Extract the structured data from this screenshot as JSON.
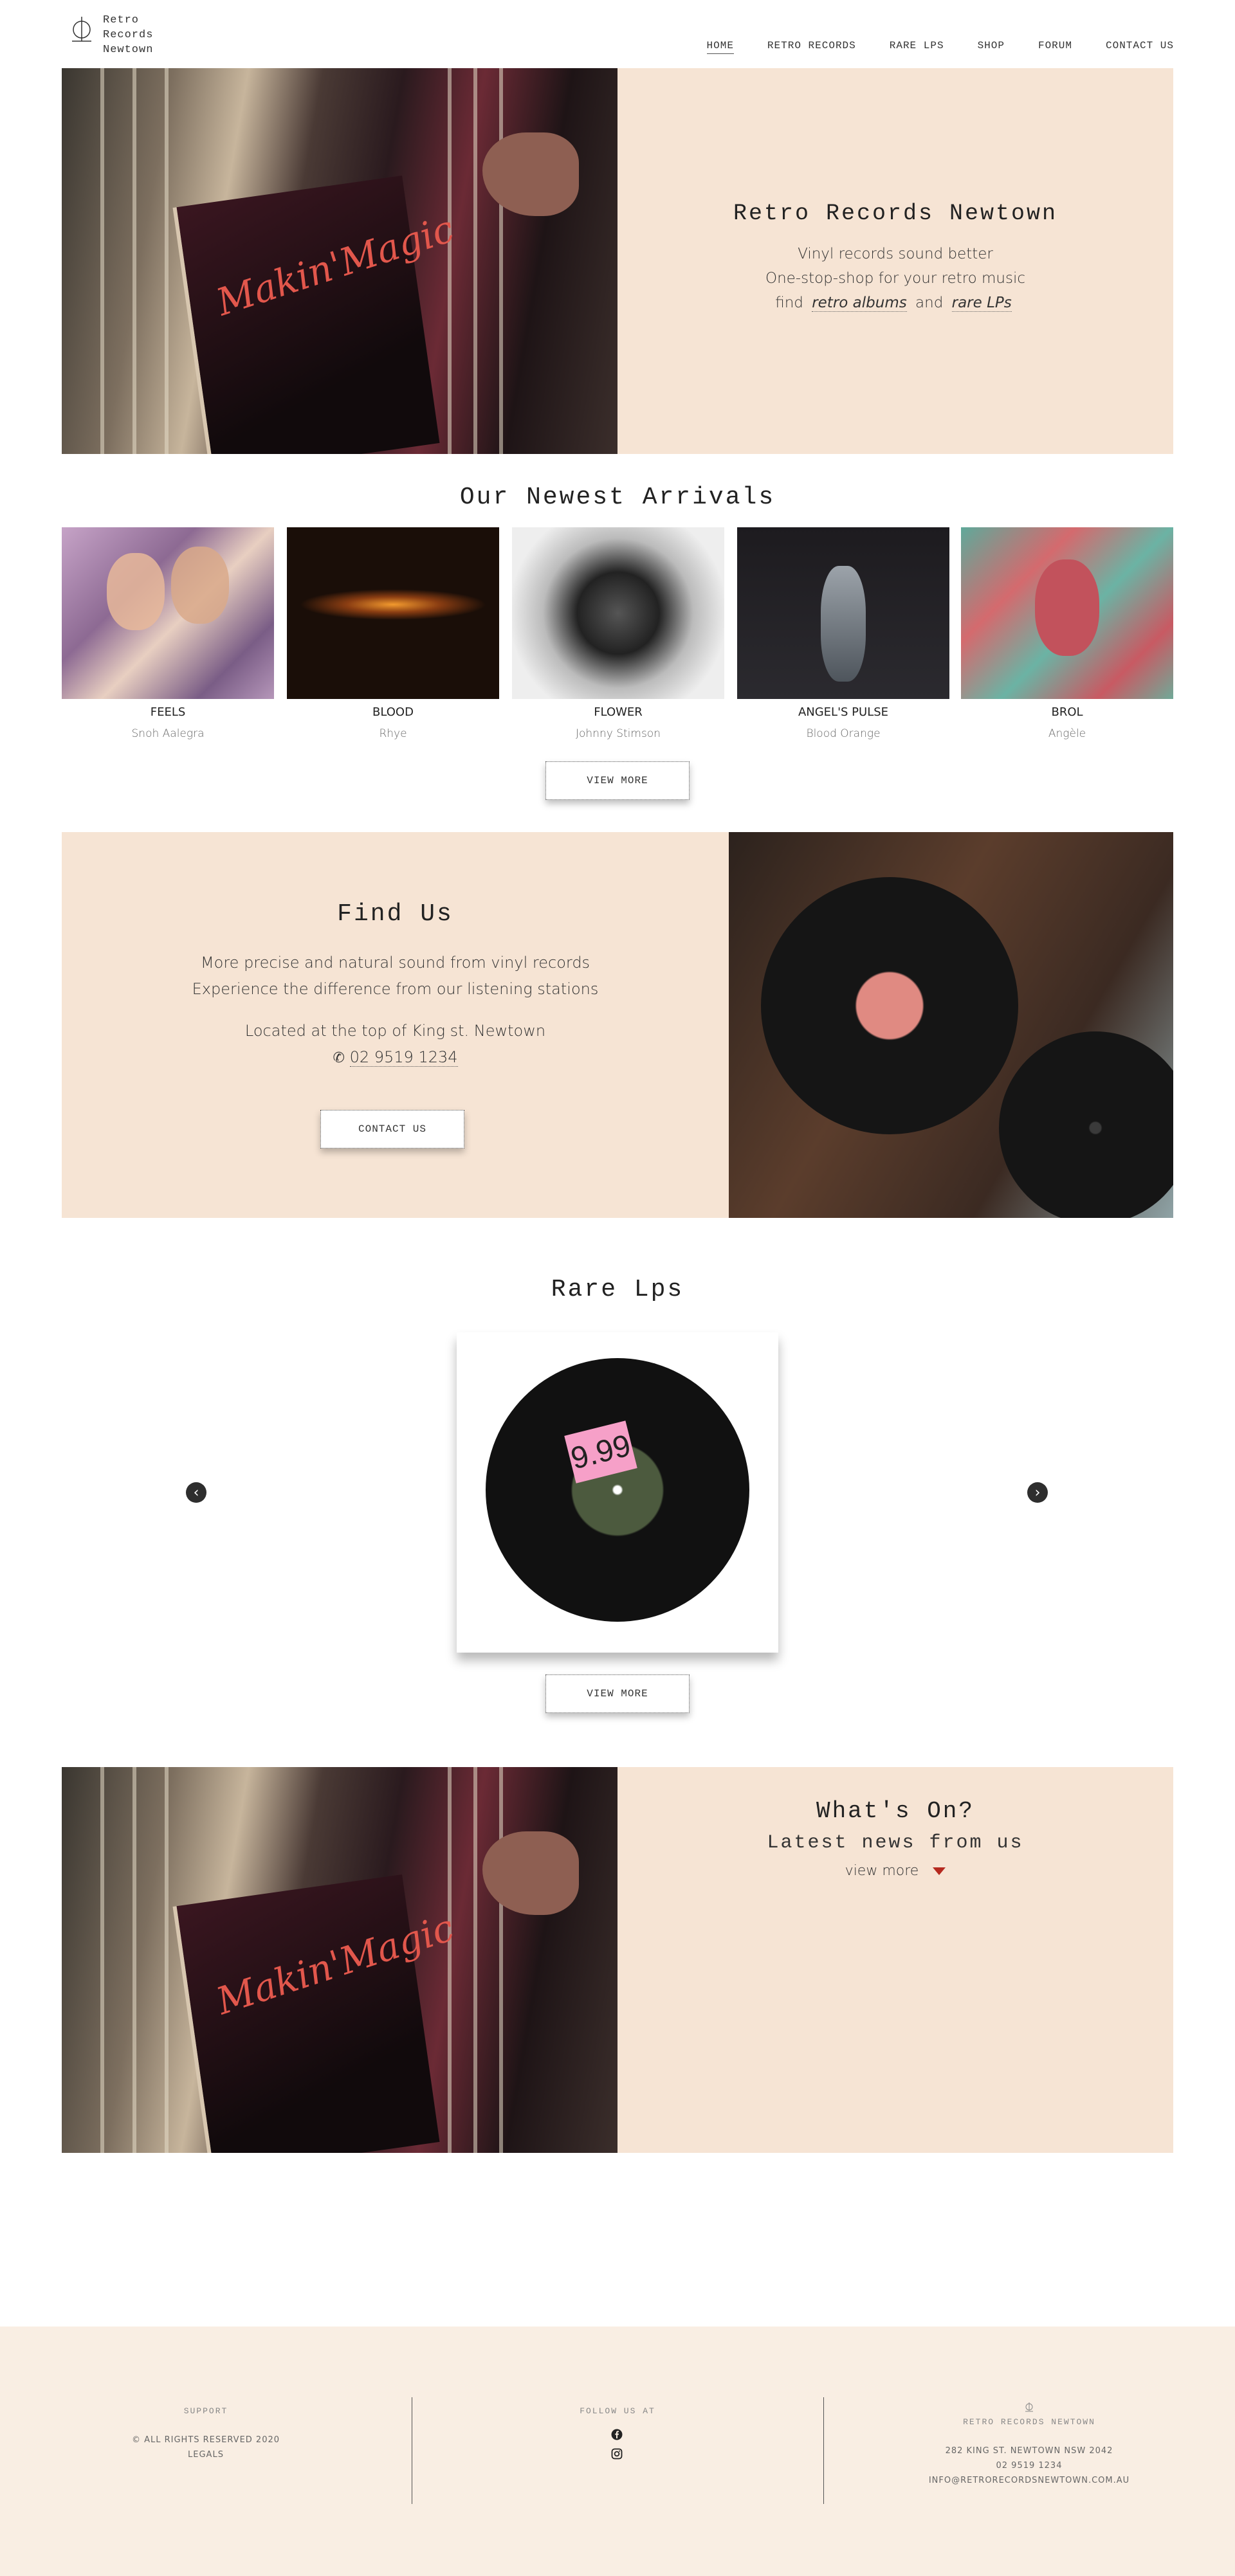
{
  "header": {
    "logo_line1": "Retro",
    "logo_line2": "Records",
    "logo_line3": "Newtown",
    "nav": [
      "HOME",
      "RETRO RECORDS",
      "RARE LPS",
      "SHOP",
      "FORUM",
      "CONTACT US"
    ]
  },
  "hero": {
    "title": "Retro Records Newtown",
    "line1": "Vinyl records sound better",
    "line2": "One-stop-shop for your retro music",
    "line3_prefix": "find",
    "link1": "retro albums",
    "line3_mid": "and",
    "link2": "rare LPs",
    "sleeve_text": "Makin'Magic"
  },
  "arrivals": {
    "title": "Our Newest Arrivals",
    "albums": [
      {
        "title": "FEELS",
        "artist": "Snoh Aalegra"
      },
      {
        "title": "BLOOD",
        "artist": "Rhye"
      },
      {
        "title": "FLOWER",
        "artist": "Johnny Stimson"
      },
      {
        "title": "ANGEL'S PULSE",
        "artist": "Blood Orange"
      },
      {
        "title": "BROL",
        "artist": "Angèle"
      }
    ],
    "view_more": "VIEW MORE"
  },
  "find_us": {
    "title": "Find Us",
    "line1": "More precise and natural sound from vinyl records",
    "line2": "Experience the difference from our listening stations",
    "line3": "Located at the top of King st. Newtown",
    "phone": "02 9519 1234",
    "contact_button": "CONTACT US"
  },
  "rare": {
    "title": "Rare Lps",
    "price_sticker": "9.99",
    "view_more": "VIEW MORE"
  },
  "whats_on": {
    "title": "What's On?",
    "subtitle": "Latest news from us",
    "view_more": "view more"
  },
  "footer": {
    "support_head": "SUPPORT",
    "rights": "© ALL RIGHTS RESERVED 2020",
    "legals": "LEGALS",
    "follow_head": "FOLLOW US AT",
    "brand_head": "RETRO RECORDS NEWTOWN",
    "address": "282 KING ST. NEWTOWN NSW 2042",
    "phone": "02 9519 1234",
    "email": "INFO@RETRORECORDSNEWTOWN.COM.AU"
  },
  "colors": {
    "beige_panel": "#f6e4d4",
    "footer_bg": "#f9eee3",
    "accent_caret": "#b5291f"
  },
  "icons": [
    "logo-mark-icon",
    "phone-icon",
    "chevron-left-icon",
    "chevron-right-icon",
    "facebook-icon",
    "instagram-icon",
    "caret-down-icon"
  ]
}
